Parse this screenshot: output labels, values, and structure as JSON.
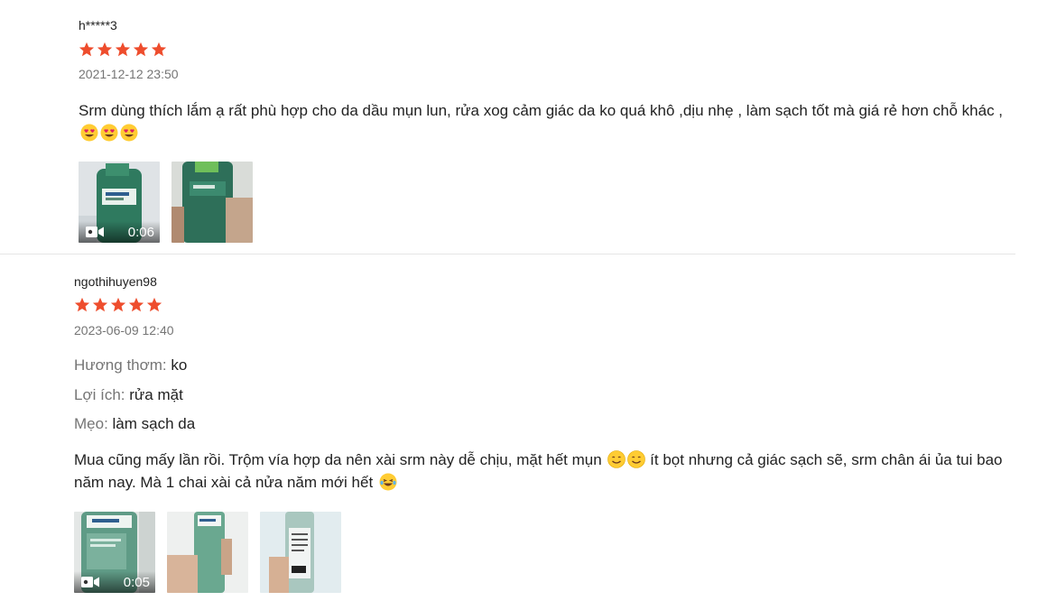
{
  "colors": {
    "star": "#ee4d2d",
    "muted": "#757575",
    "text": "#222222"
  },
  "reviews": [
    {
      "username": "h*****3",
      "rating": 5,
      "date": "2021-12-12 23:50",
      "attributes": [],
      "text": "Srm dùng thích lắm ạ rất phù hợp cho da dầu mụn lun, rửa xog cảm giác da ko quá khô ,dịu nhẹ , làm sạch tốt mà giá rẻ hơn chỗ khác ,",
      "text_emojis": [
        "heart-eyes-emoji",
        "heart-eyes-emoji",
        "heart-eyes-emoji"
      ],
      "media": [
        {
          "type": "video",
          "duration": "0:06"
        },
        {
          "type": "image"
        }
      ]
    },
    {
      "username": "ngothihuyen98",
      "rating": 5,
      "date": "2023-06-09 12:40",
      "attributes": [
        {
          "label": "Hương thơm:",
          "value": "ko"
        },
        {
          "label": "Lợi ích:",
          "value": "rửa mặt"
        },
        {
          "label": "Mẹo:",
          "value": "làm sạch da"
        }
      ],
      "text_part1": "Mua cũng mấy lần rồi. Trộm vía hợp da nên xài srm này dễ chịu, mặt hết mụn",
      "text_part2": "ít bọt nhưng cả giác sạch sẽ, srm chân ái  ủa tui bao năm nay. Mà 1 chai xài cả nửa năm mới hết",
      "text_emojis": [
        "smiling-emoji",
        "smiling-emoji",
        "laughing-tears-emoji"
      ],
      "media": [
        {
          "type": "video",
          "duration": "0:05"
        },
        {
          "type": "image"
        },
        {
          "type": "image"
        }
      ]
    }
  ]
}
